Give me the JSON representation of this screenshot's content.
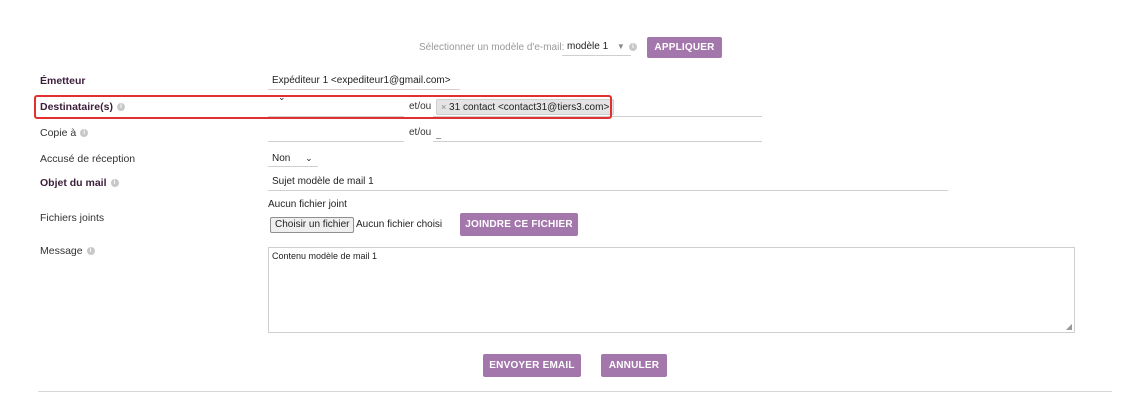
{
  "template": {
    "label": "Sélectionner un modèle d'e-mail:",
    "value": "modèle 1",
    "apply": "APPLIQUER"
  },
  "emitter": {
    "label": "Émetteur",
    "value": "Expéditeur 1 <expediteur1@gmail.com>"
  },
  "recipients": {
    "label": "Destinataire(s)",
    "andor": "et/ou",
    "tag_remove": "×",
    "tag": "31 contact <contact31@tiers3.com>",
    "highlight_color": "#e0302f"
  },
  "copy": {
    "label": "Copie à",
    "andor": "et/ou"
  },
  "receipt": {
    "label": "Accusé de réception",
    "value": "Non"
  },
  "subject": {
    "label": "Objet du mail",
    "value": "Sujet modèle de mail 1"
  },
  "attachments": {
    "label": "Fichiers joints",
    "none": "Aucun fichier joint",
    "choose": "Choisir un fichier",
    "none_chosen": "Aucun fichier choisi",
    "attach": "JOINDRE CE FICHIER"
  },
  "message": {
    "label": "Message",
    "value": "Contenu modèle de mail 1"
  },
  "actions": {
    "send": "ENVOYER EMAIL",
    "cancel": "ANNULER"
  },
  "colors": {
    "accent": "#a477ac",
    "label_bold": "#3c1e3a"
  }
}
